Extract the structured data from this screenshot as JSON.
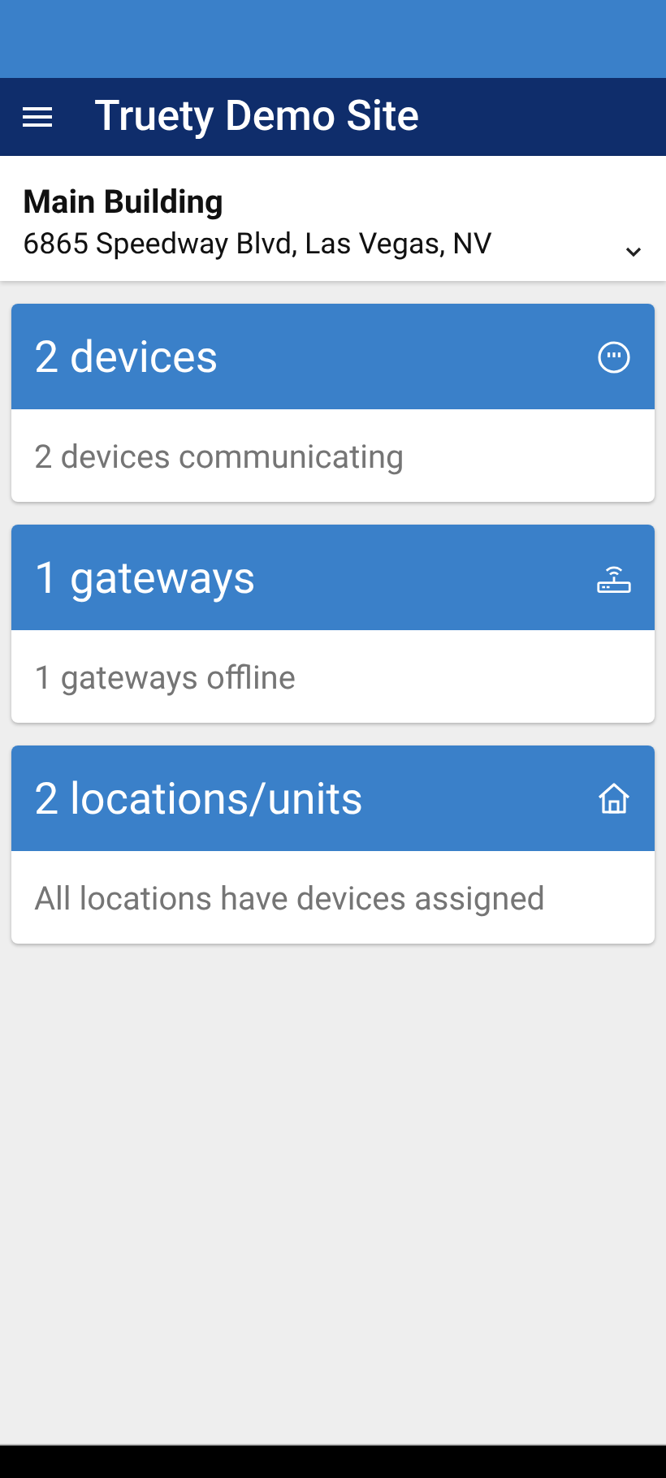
{
  "app_bar": {
    "title": "Truety Demo Site"
  },
  "location": {
    "name": "Main Building",
    "address": "6865 Speedway Blvd, Las Vegas, NV"
  },
  "cards": [
    {
      "kind": "devices",
      "title": "2 devices",
      "status": "2 devices communicating"
    },
    {
      "kind": "gateways",
      "title": "1 gateways",
      "status": "1 gateways offline"
    },
    {
      "kind": "locations",
      "title": "2 locations/units",
      "status": "All locations have devices assigned"
    }
  ]
}
